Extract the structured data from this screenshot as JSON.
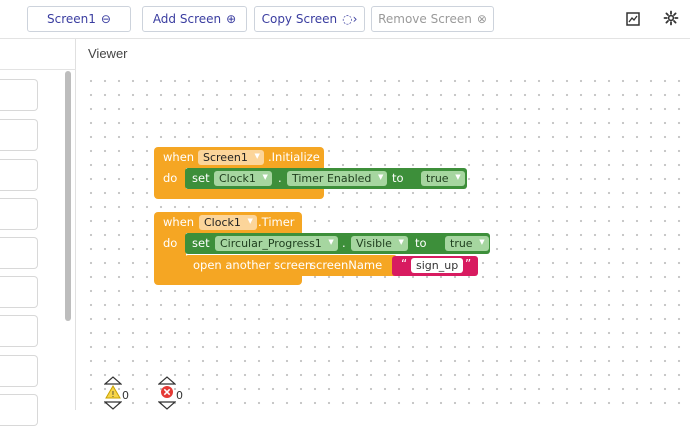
{
  "toolbar": {
    "screen_select": "Screen1",
    "add_screen": "Add Screen",
    "copy_screen": "Copy Screen",
    "remove_screen": "Remove Screen"
  },
  "viewer": {
    "title": "Viewer"
  },
  "blocks": {
    "when1": "when",
    "screen1": "Screen1",
    "initialize": ".Initialize",
    "do1": "do",
    "set1": "set",
    "clock1a": "Clock1",
    "dot1": ".",
    "timer_enabled": "Timer Enabled",
    "to1": "to",
    "true1": "true",
    "when2": "when",
    "clock1b": "Clock1",
    "timer_event": ".Timer",
    "do2": "do",
    "set2": "set",
    "progress": "Circular_Progress1",
    "dot2": ".",
    "visible": "Visible",
    "to2": "to",
    "true2": "true",
    "open_screen": "open another screen",
    "screen_name": "screenName",
    "quote_open": "“",
    "sign_up": "sign_up",
    "quote_close": "”"
  },
  "status": {
    "warnings": "0",
    "errors": "0"
  },
  "colors": {
    "event": "#f5a623",
    "component": "#3d8f3a",
    "text": "#d81b60",
    "accent": "#3a3da0"
  }
}
